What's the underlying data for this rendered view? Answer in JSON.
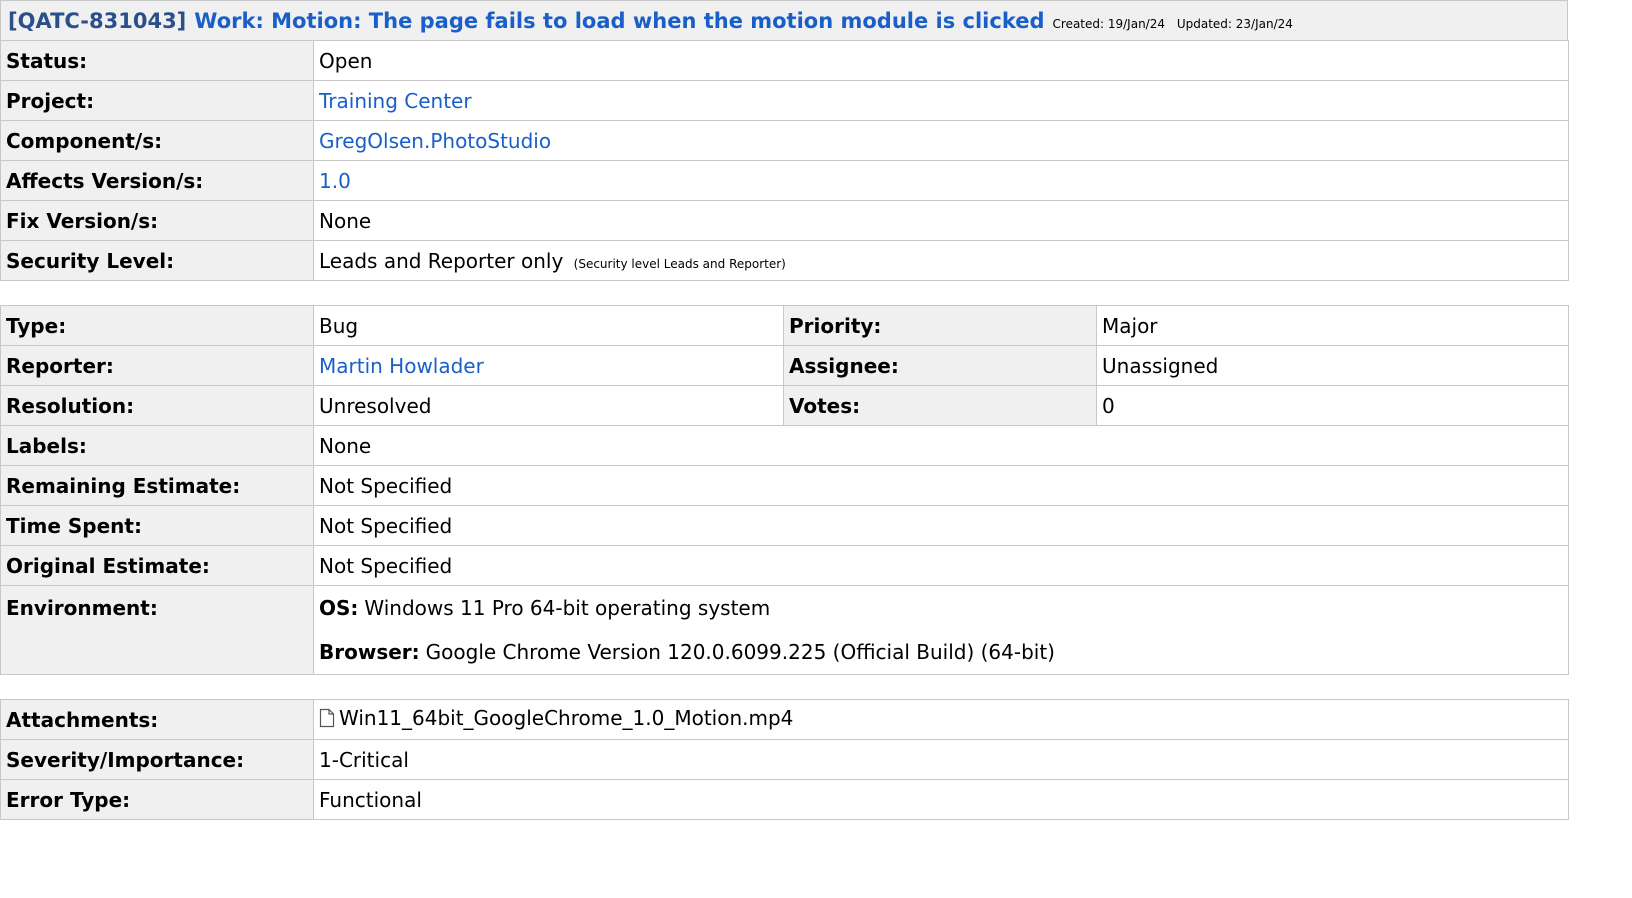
{
  "issue": {
    "key": "[QATC-831043]",
    "summary": "Work: Motion: The page fails to load when the motion module is clicked",
    "created": "Created: 19/Jan/24",
    "updated": "Updated: 23/Jan/24"
  },
  "details": {
    "status_label": "Status:",
    "status": "Open",
    "project_label": "Project:",
    "project": "Training Center",
    "component_label": "Component/s:",
    "component": "GregOlsen.PhotoStudio",
    "affects_label": "Affects Version/s:",
    "affects": "1.0",
    "fix_label": "Fix Version/s:",
    "fix": "None",
    "security_label": "Security Level:",
    "security": "Leads and Reporter only",
    "security_note": "(Security level Leads and Reporter)"
  },
  "people": {
    "type_label": "Type:",
    "type": "Bug",
    "priority_label": "Priority:",
    "priority": "Major",
    "reporter_label": "Reporter:",
    "reporter": "Martin Howlader",
    "assignee_label": "Assignee:",
    "assignee": "Unassigned",
    "resolution_label": "Resolution:",
    "resolution": "Unresolved",
    "votes_label": "Votes:",
    "votes": "0",
    "labels_label": "Labels:",
    "labels": "None",
    "remaining_label": "Remaining Estimate:",
    "remaining": "Not Specified",
    "spent_label": "Time Spent:",
    "spent": "Not Specified",
    "original_label": "Original Estimate:",
    "original": "Not Specified",
    "env_label": "Environment:",
    "env_os_label": "OS:",
    "env_os": "Windows 11 Pro 64-bit operating system",
    "env_browser_label": "Browser:",
    "env_browser": "Google Chrome Version 120.0.6099.225 (Official Build) (64-bit)"
  },
  "extra": {
    "attachments_label": "Attachments:",
    "attachment_file": "Win11_64bit_GoogleChrome_1.0_Motion.mp4",
    "severity_label": "Severity/Importance:",
    "severity": "1-Critical",
    "error_label": "Error Type:",
    "error": "Functional"
  }
}
